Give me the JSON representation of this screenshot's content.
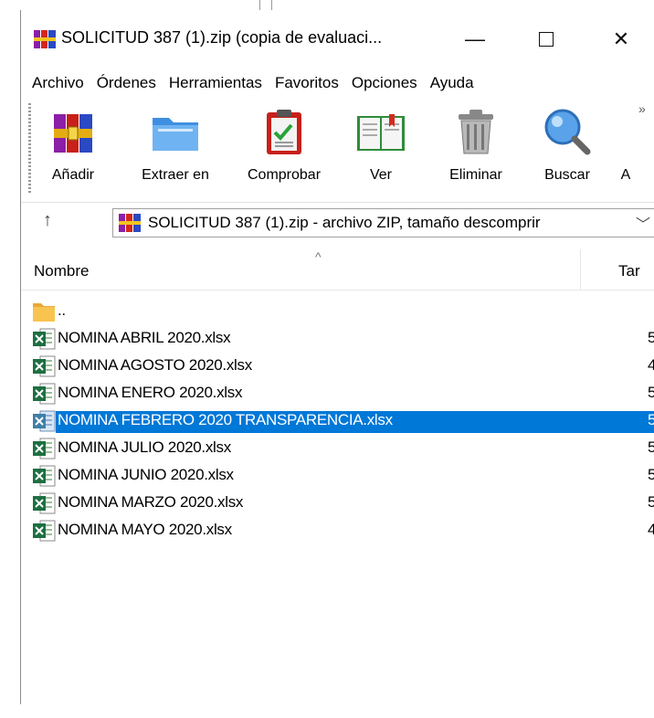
{
  "window": {
    "title": "SOLICITUD 387 (1).zip (copia de evaluaci...",
    "controls": {
      "minimize": "—",
      "maximize": "□",
      "close": "✕"
    }
  },
  "menu": [
    "Archivo",
    "Órdenes",
    "Herramientas",
    "Favoritos",
    "Opciones",
    "Ayuda"
  ],
  "toolbar": {
    "overflow": "»",
    "tools": [
      {
        "label": "Añadir",
        "icon": "winrar-add-icon"
      },
      {
        "label": "Extraer en",
        "icon": "folder-extract-icon"
      },
      {
        "label": "Comprobar",
        "icon": "clipboard-check-icon"
      },
      {
        "label": "Ver",
        "icon": "open-book-icon"
      },
      {
        "label": "Eliminar",
        "icon": "trash-bin-icon"
      },
      {
        "label": "Buscar",
        "icon": "magnifier-icon"
      },
      {
        "label": "A",
        "icon": ""
      }
    ]
  },
  "address": {
    "up_arrow": "↑",
    "path": "SOLICITUD 387 (1).zip - archivo ZIP, tamaño descomprir",
    "dropdown": "﹀"
  },
  "columns": {
    "name": "Nombre",
    "size": "Tar",
    "sort_indicator": "^"
  },
  "files": [
    {
      "name": "..",
      "size": "",
      "type": "folder"
    },
    {
      "name": "NOMINA ABRIL 2020.xlsx",
      "size": "5",
      "type": "xlsx"
    },
    {
      "name": "NOMINA AGOSTO 2020.xlsx",
      "size": "4",
      "type": "xlsx"
    },
    {
      "name": "NOMINA ENERO 2020.xlsx",
      "size": "5",
      "type": "xlsx"
    },
    {
      "name": "NOMINA FEBRERO 2020 TRANSPARENCIA.xlsx",
      "size": "5",
      "type": "xlsx",
      "selected": true
    },
    {
      "name": "NOMINA JULIO 2020.xlsx",
      "size": "5",
      "type": "xlsx"
    },
    {
      "name": "NOMINA JUNIO 2020.xlsx",
      "size": "5",
      "type": "xlsx"
    },
    {
      "name": "NOMINA MARZO 2020.xlsx",
      "size": "5",
      "type": "xlsx"
    },
    {
      "name": "NOMINA MAYO 2020.xlsx",
      "size": "4",
      "type": "xlsx"
    }
  ],
  "colors": {
    "selection": "#0078d7",
    "excel_green": "#1d6f42",
    "folder_yellow": "#f8c44f"
  }
}
